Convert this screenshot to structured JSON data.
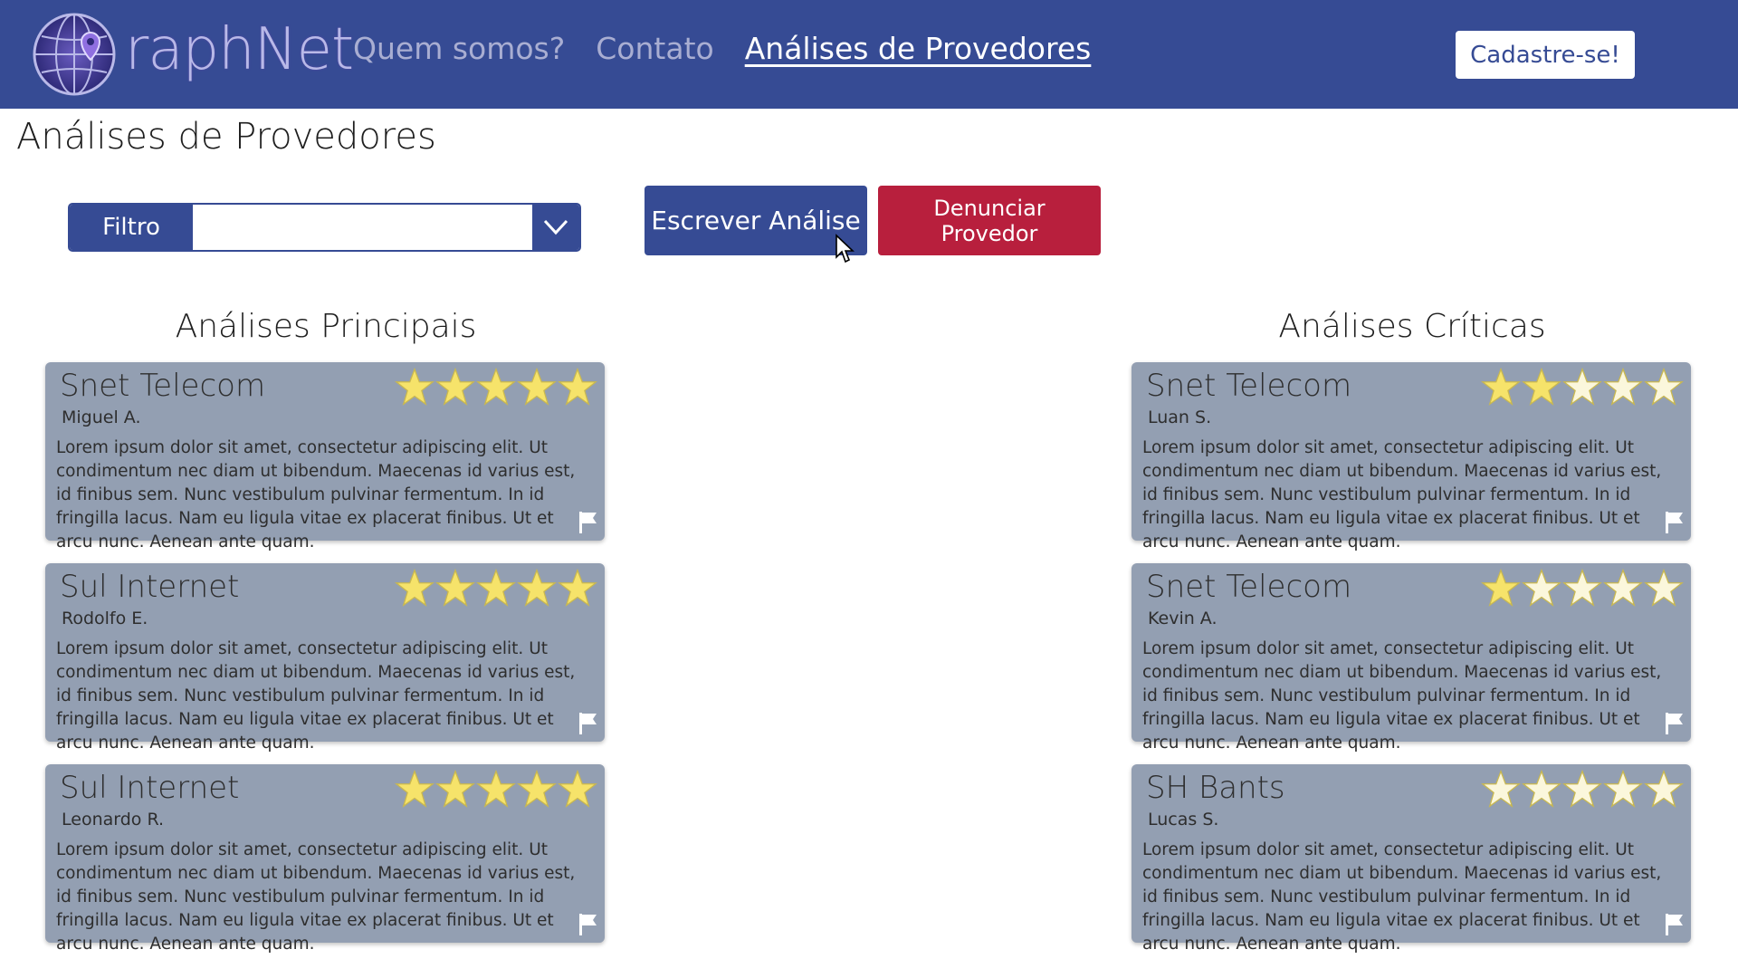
{
  "header": {
    "logo_text": "raphNet",
    "nav": [
      {
        "label": "Quem somos?"
      },
      {
        "label": "Contato"
      },
      {
        "label": "Análises de Provedores"
      }
    ],
    "signup_label": "Cadastre-se!"
  },
  "page_title": "Análises de Provedores",
  "filter": {
    "label": "Filtro",
    "value": "",
    "placeholder": ""
  },
  "actions": {
    "write_label": "Escrever Análise",
    "report_label": "Denunciar Provedor"
  },
  "columns": [
    {
      "title": "Análises Principais",
      "reviews": [
        {
          "provider": "Snet Telecom",
          "author": "Miguel A.",
          "rating": 5,
          "text": "Lorem ipsum dolor sit amet, consectetur adipiscing elit. Ut condimentum nec diam ut bibendum. Maecenas id varius est, id finibus sem. Nunc vestibulum pulvinar fermentum. In id fringilla lacus. Nam eu ligula vitae ex placerat finibus. Ut et arcu nunc. Aenean ante quam."
        },
        {
          "provider": "Sul Internet",
          "author": "Rodolfo E.",
          "rating": 5,
          "text": "Lorem ipsum dolor sit amet, consectetur adipiscing elit. Ut condimentum nec diam ut bibendum. Maecenas id varius est, id finibus sem. Nunc vestibulum pulvinar fermentum. In id fringilla lacus. Nam eu ligula vitae ex placerat finibus. Ut et arcu nunc. Aenean ante quam."
        },
        {
          "provider": "Sul Internet",
          "author": "Leonardo R.",
          "rating": 5,
          "text": "Lorem ipsum dolor sit amet, consectetur adipiscing elit. Ut condimentum nec diam ut bibendum. Maecenas id varius est, id finibus sem. Nunc vestibulum pulvinar fermentum. In id fringilla lacus. Nam eu ligula vitae ex placerat finibus. Ut et arcu nunc. Aenean ante quam."
        }
      ]
    },
    {
      "title": "Análises Críticas",
      "reviews": [
        {
          "provider": "Snet Telecom",
          "author": "Luan S.",
          "rating": 2,
          "text": "Lorem ipsum dolor sit amet, consectetur adipiscing elit. Ut condimentum nec diam ut bibendum. Maecenas id varius est, id finibus sem. Nunc vestibulum pulvinar fermentum. In id fringilla lacus. Nam eu ligula vitae ex placerat finibus. Ut et arcu nunc. Aenean ante quam."
        },
        {
          "provider": "Snet Telecom",
          "author": "Kevin A.",
          "rating": 1,
          "text": "Lorem ipsum dolor sit amet, consectetur adipiscing elit. Ut condimentum nec diam ut bibendum. Maecenas id varius est, id finibus sem. Nunc vestibulum pulvinar fermentum. In id fringilla lacus. Nam eu ligula vitae ex placerat finibus. Ut et arcu nunc. Aenean ante quam."
        },
        {
          "provider": "SH Bants",
          "author": "Lucas S.",
          "rating": 0,
          "text": "Lorem ipsum dolor sit amet, consectetur adipiscing elit. Ut condimentum nec diam ut bibendum. Maecenas id varius est, id finibus sem. Nunc vestibulum pulvinar fermentum. In id fringilla lacus. Nam eu ligula vitae ex placerat finibus. Ut et arcu nunc. Aenean ante quam."
        }
      ]
    }
  ],
  "colors": {
    "brand": "#364b94",
    "danger": "#b81f3d",
    "card": "#939fb2",
    "star_filled": "#f6e36a",
    "star_empty": "#fbf7dc"
  },
  "icons": {
    "logo": "globe-pin-icon",
    "dropdown": "chevron-down-icon",
    "star": "star-icon",
    "flag": "flag-icon",
    "cursor": "mouse-pointer-icon"
  }
}
